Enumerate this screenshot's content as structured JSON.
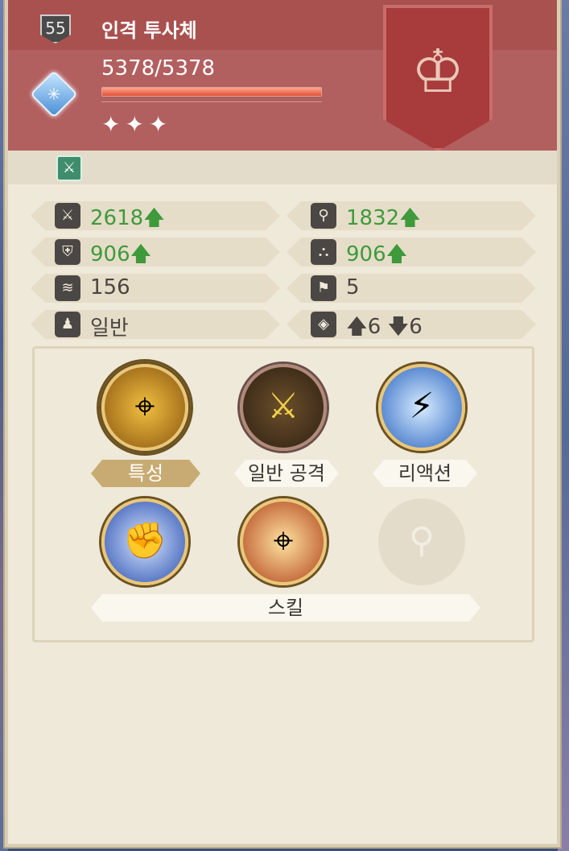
{
  "character": {
    "level": "55",
    "name": "인격 투사체",
    "hp": "5378/5378",
    "hp_fraction": 1.0,
    "stars": "✦✦✦"
  },
  "stats": [
    {
      "icon": "sword-icon",
      "glyph": "⚔",
      "value": "2618",
      "up": true
    },
    {
      "icon": "staff-icon",
      "glyph": "⚲",
      "value": "1832",
      "up": true
    },
    {
      "icon": "shield-icon",
      "glyph": "⛨",
      "value": "906",
      "up": true
    },
    {
      "icon": "wizard-hat-icon",
      "glyph": "⛬",
      "value": "906",
      "up": true
    },
    {
      "icon": "wing-icon",
      "glyph": "≋",
      "value": "156",
      "up": false
    },
    {
      "icon": "boot-icon",
      "glyph": "⚑",
      "value": "5",
      "up": false
    },
    {
      "icon": "class-icon",
      "glyph": "♟",
      "value": "일반",
      "up": false
    },
    {
      "icon": "range-icon",
      "glyph": "◈",
      "value": "🡅6 🡇6",
      "up": false
    }
  ],
  "up_arrow": "🡅",
  "skills": {
    "trait_label": "특성",
    "normal_attack_label": "일반 공격",
    "reaction_label": "리액션",
    "skill_label": "스킬"
  },
  "colors": {
    "header": "#b25f5f",
    "panel": "#efe9da",
    "stat_up": "#3f9a3c"
  }
}
